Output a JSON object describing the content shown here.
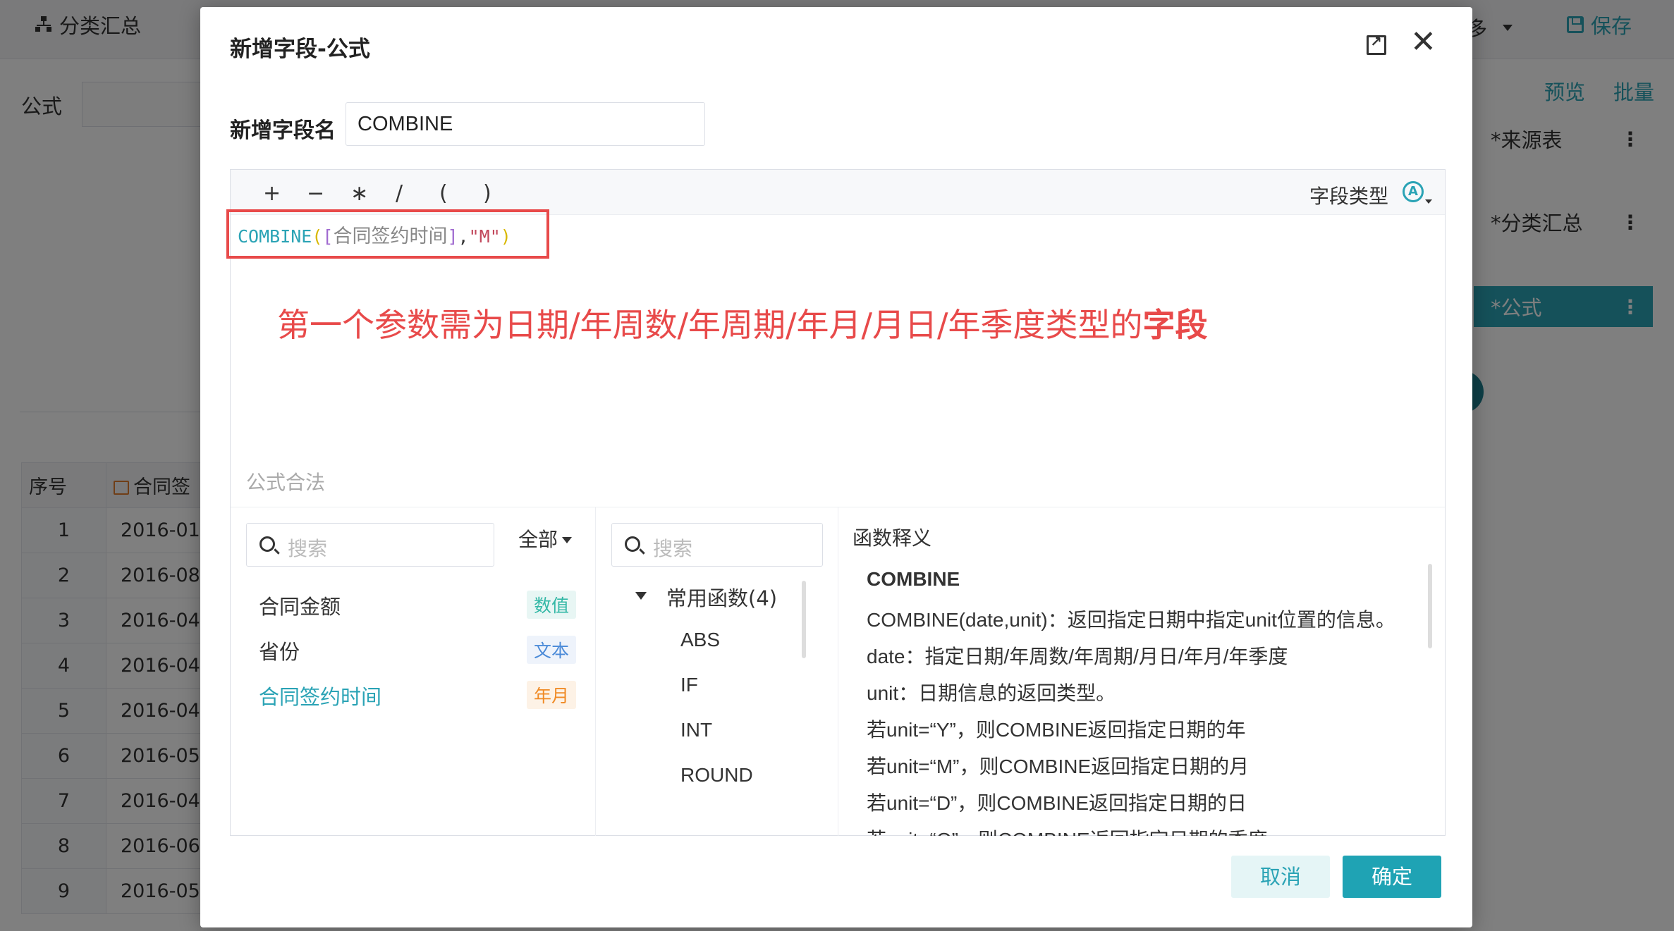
{
  "background": {
    "tab_label": "分类汇总",
    "more_label": "多",
    "save_label": "保存",
    "formula_label": "公式",
    "preview_label": "预览",
    "batch_label": "批量",
    "nodes": [
      "*来源表",
      "*分类汇总",
      "*公式"
    ],
    "table": {
      "col_index": "序号",
      "col_date": "合同签",
      "rows": [
        {
          "idx": "1",
          "val": "2016-01"
        },
        {
          "idx": "2",
          "val": "2016-08"
        },
        {
          "idx": "3",
          "val": "2016-04"
        },
        {
          "idx": "4",
          "val": "2016-04"
        },
        {
          "idx": "5",
          "val": "2016-04"
        },
        {
          "idx": "6",
          "val": "2016-05"
        },
        {
          "idx": "7",
          "val": "2016-04"
        },
        {
          "idx": "8",
          "val": "2016-06"
        },
        {
          "idx": "9",
          "val": "2016-05"
        }
      ]
    }
  },
  "dialog": {
    "title": "新增字段-公式",
    "field_name_label": "新增字段名",
    "field_name_value": "COMBINE",
    "operators": [
      "+",
      "−",
      "∗",
      "/",
      "(",
      ")"
    ],
    "field_type_label": "字段类型",
    "formula": {
      "fn": "COMBINE",
      "open_paren": "(",
      "open_bracket": "[",
      "field": "合同签约时间",
      "close_bracket": "]",
      "comma": ",",
      "arg": "\"M\"",
      "close_paren": ")"
    },
    "hint_text": "第一个参数需为日期/年周数/年周期/年月/月日/年季度类型的",
    "hint_bold": "字段",
    "valid_text": "公式合法",
    "fields_panel": {
      "search_placeholder": "搜索",
      "filter_label": "全部",
      "items": [
        {
          "name": "合同金额",
          "type": "数值"
        },
        {
          "name": "省份",
          "type": "文本"
        },
        {
          "name": "合同签约时间",
          "type": "年月"
        }
      ]
    },
    "functions_panel": {
      "search_placeholder": "搜索",
      "group_label": "常用函数(4)",
      "items": [
        "ABS",
        "IF",
        "INT",
        "ROUND"
      ]
    },
    "doc_panel": {
      "title": "函数释义",
      "lines": [
        "COMBINE",
        "COMBINE(date,unit)：返回指定日期中指定unit位置的信息。",
        "date：指定日期/年周数/年周期/月日/年月/年季度",
        "unit：日期信息的返回类型。",
        "若unit=“Y”，则COMBINE返回指定日期的年",
        "若unit=“M”，则COMBINE返回指定日期的月",
        "若unit=“D”，则COMBINE返回指定日期的日",
        "若unit=“Q”，则COMBINE返回指定日期的季度"
      ]
    },
    "cancel_label": "取消",
    "ok_label": "确定"
  }
}
